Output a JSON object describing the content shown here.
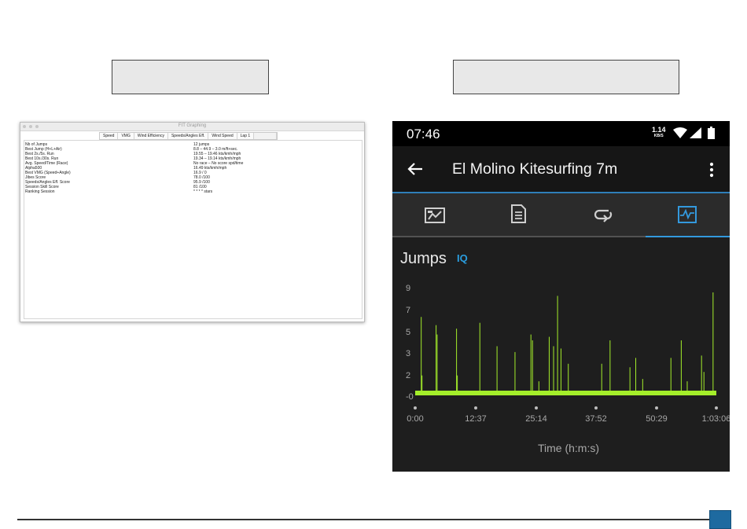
{
  "desktop_window": {
    "title": "FIT Graphing",
    "tabs": [
      "Speed",
      "VMG",
      "Wind Efficiency",
      "Speeds/Angles Eff.",
      "Wind Speed",
      "Lap 1"
    ],
    "rows": [
      {
        "label": "Nb of Jumps",
        "value": "12 jumps"
      },
      {
        "label": "Best Jump (H+L+Air)",
        "value": "8.8 – 44.9 – 3.0 m/ft+sec."
      },
      {
        "label": "Best 2s./5s. Run",
        "value": "19.55 – 19.46 kts/kmh/mph"
      },
      {
        "label": "Best 10s./30s. Run",
        "value": "19.34 – 19.14 kts/kmh/mph"
      },
      {
        "label": "Avg. Speed/Time (Race)",
        "value": "No race – No score spd/time"
      },
      {
        "label": "Alpha500",
        "value": "16.49 kts/kmh/mph"
      },
      {
        "label": "Best VMG (Speed+Angle)",
        "value": "16.9 / 0"
      },
      {
        "label": "Jibes Score",
        "value": "78.0 /100"
      },
      {
        "label": "Speeds/Angles Eff. Score",
        "value": "95.9 /100"
      },
      {
        "label": "Session Skill Score",
        "value": "81 /100"
      },
      {
        "label": "Ranking Session",
        "value": "* * * * stars"
      }
    ]
  },
  "phone": {
    "status_time": "07:46",
    "net_speed": "1.14",
    "net_unit": "KB/S",
    "title": "El Molino Kitesurfing 7m",
    "tabs": [
      "overview-tab",
      "details-tab",
      "laps-tab",
      "charts-tab"
    ],
    "section_title": "Jumps",
    "iq_badge": "IQ",
    "accent_color": "#3399dd",
    "series_color": "#a4ee2a"
  },
  "chart_data": {
    "type": "line",
    "title": "Jumps",
    "xlabel": "Time (h:m:s)",
    "ylabel": "",
    "y_ticks": [
      "9",
      "7",
      "5",
      "3",
      "2",
      "-0"
    ],
    "x_ticks": [
      "0:00",
      "12:37",
      "25:14",
      "37:52",
      "50:29",
      "1:03:06"
    ],
    "ylim": [
      0,
      10
    ],
    "xlim_seconds": [
      0,
      3786
    ],
    "grid": false,
    "spikes": [
      {
        "t": 76,
        "v": 6.5
      },
      {
        "t": 86,
        "v": 1.5
      },
      {
        "t": 263,
        "v": 5.8
      },
      {
        "t": 276,
        "v": 5.0
      },
      {
        "t": 520,
        "v": 5.5
      },
      {
        "t": 530,
        "v": 1.5
      },
      {
        "t": 813,
        "v": 6.0
      },
      {
        "t": 1029,
        "v": 4.0
      },
      {
        "t": 1255,
        "v": 3.5
      },
      {
        "t": 1455,
        "v": 5.0
      },
      {
        "t": 1475,
        "v": 4.5
      },
      {
        "t": 1555,
        "v": 1.0
      },
      {
        "t": 1685,
        "v": 4.8
      },
      {
        "t": 1740,
        "v": 4.0
      },
      {
        "t": 1790,
        "v": 8.3
      },
      {
        "t": 1833,
        "v": 3.8
      },
      {
        "t": 1925,
        "v": 2.5
      },
      {
        "t": 2345,
        "v": 2.5
      },
      {
        "t": 2450,
        "v": 4.5
      },
      {
        "t": 2700,
        "v": 2.2
      },
      {
        "t": 2773,
        "v": 3.0
      },
      {
        "t": 2860,
        "v": 1.2
      },
      {
        "t": 3215,
        "v": 3.0
      },
      {
        "t": 3345,
        "v": 4.5
      },
      {
        "t": 3420,
        "v": 1.0
      },
      {
        "t": 3600,
        "v": 3.2
      },
      {
        "t": 3630,
        "v": 1.8
      },
      {
        "t": 3745,
        "v": 8.6
      }
    ]
  }
}
